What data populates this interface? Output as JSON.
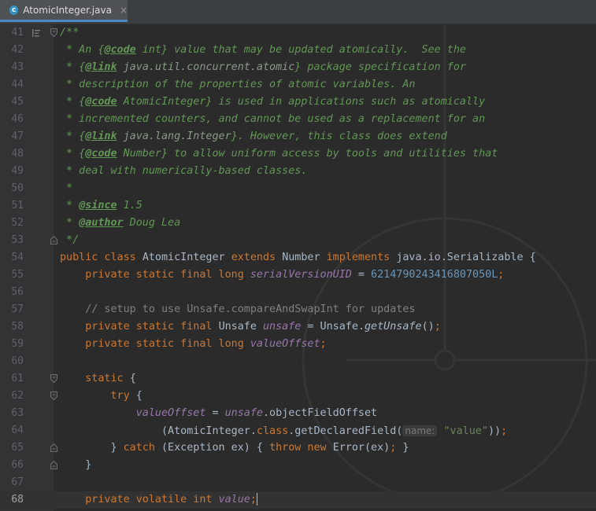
{
  "tab": {
    "filename": "AtomicInteger.java",
    "icon": "java-class-icon",
    "icon_letter": "c",
    "close": "×"
  },
  "editor": {
    "current_line": "68",
    "lines": [
      {
        "n": "41",
        "fold": "start",
        "segs": [
          [
            "cm",
            "/**"
          ]
        ]
      },
      {
        "n": "42",
        "segs": [
          [
            "cm",
            " * An {"
          ],
          [
            "tag",
            "@code"
          ],
          [
            "cm",
            " int} value that may be updated atomically.  See the"
          ]
        ]
      },
      {
        "n": "43",
        "segs": [
          [
            "cm",
            " * {"
          ],
          [
            "tag",
            "@link"
          ],
          [
            "ref",
            " java.util.concurrent.atomic"
          ],
          [
            "cm",
            "} package specification for"
          ]
        ]
      },
      {
        "n": "44",
        "segs": [
          [
            "cm",
            " * description of the properties of atomic variables. An"
          ]
        ]
      },
      {
        "n": "45",
        "segs": [
          [
            "cm",
            " * {"
          ],
          [
            "tag",
            "@code"
          ],
          [
            "cm",
            " AtomicInteger} is used in applications such as atomically"
          ]
        ]
      },
      {
        "n": "46",
        "segs": [
          [
            "cm",
            " * incremented counters, and cannot be used as a replacement for an"
          ]
        ]
      },
      {
        "n": "47",
        "segs": [
          [
            "cm",
            " * {"
          ],
          [
            "tag",
            "@link"
          ],
          [
            "ref",
            " java.lang.Integer"
          ],
          [
            "cm",
            "}. However, this class does extend"
          ]
        ]
      },
      {
        "n": "48",
        "segs": [
          [
            "cm",
            " * {"
          ],
          [
            "tag",
            "@code"
          ],
          [
            "cm",
            " Number} to allow uniform access by tools and utilities that"
          ]
        ]
      },
      {
        "n": "49",
        "segs": [
          [
            "cm",
            " * deal with numerically-based classes."
          ]
        ]
      },
      {
        "n": "50",
        "segs": [
          [
            "cm",
            " *"
          ]
        ]
      },
      {
        "n": "51",
        "segs": [
          [
            "cm",
            " * "
          ],
          [
            "tag",
            "@since"
          ],
          [
            "cm",
            " 1.5"
          ]
        ]
      },
      {
        "n": "52",
        "segs": [
          [
            "cm",
            " * "
          ],
          [
            "tag",
            "@author"
          ],
          [
            "cm",
            " Doug Lea"
          ]
        ]
      },
      {
        "n": "53",
        "fold": "end",
        "segs": [
          [
            "cm",
            " */"
          ]
        ]
      },
      {
        "n": "54",
        "segs": [
          [
            "kw",
            "public class "
          ],
          [
            "",
            "AtomicInteger "
          ],
          [
            "kw",
            "extends "
          ],
          [
            "",
            "Number "
          ],
          [
            "kw",
            "implements "
          ],
          [
            "",
            "java.io.Serializable {"
          ]
        ]
      },
      {
        "n": "55",
        "segs": [
          [
            "",
            "    "
          ],
          [
            "kw",
            "private static final long "
          ],
          [
            "fld",
            "serialVersionUID"
          ],
          [
            "",
            " = "
          ],
          [
            "num",
            "6214790243416807050L"
          ],
          [
            "kw",
            ";"
          ]
        ]
      },
      {
        "n": "56",
        "segs": []
      },
      {
        "n": "57",
        "segs": [
          [
            "",
            "    "
          ],
          [
            "lc",
            "// setup to use Unsafe.compareAndSwapInt for updates"
          ]
        ]
      },
      {
        "n": "58",
        "segs": [
          [
            "",
            "    "
          ],
          [
            "kw",
            "private static final "
          ],
          [
            "",
            "Unsafe "
          ],
          [
            "fld",
            "unsafe"
          ],
          [
            "",
            " = Unsafe."
          ],
          [
            "mth",
            "getUnsafe"
          ],
          [
            "",
            "()"
          ],
          [
            "kw",
            ";"
          ]
        ]
      },
      {
        "n": "59",
        "segs": [
          [
            "",
            "    "
          ],
          [
            "kw",
            "private static final long "
          ],
          [
            "fld",
            "valueOffset"
          ],
          [
            "kw",
            ";"
          ]
        ]
      },
      {
        "n": "60",
        "segs": []
      },
      {
        "n": "61",
        "fold": "start",
        "segs": [
          [
            "",
            "    "
          ],
          [
            "kw",
            "static "
          ],
          [
            "",
            "{"
          ]
        ]
      },
      {
        "n": "62",
        "fold": "start",
        "segs": [
          [
            "",
            "        "
          ],
          [
            "kw",
            "try "
          ],
          [
            "",
            "{"
          ]
        ]
      },
      {
        "n": "63",
        "segs": [
          [
            "",
            "            "
          ],
          [
            "fld",
            "valueOffset"
          ],
          [
            "",
            " = "
          ],
          [
            "fld",
            "unsafe"
          ],
          [
            "",
            ".objectFieldOffset"
          ]
        ]
      },
      {
        "n": "64",
        "segs": [
          [
            "",
            "                (AtomicInteger."
          ],
          [
            "kw",
            "class"
          ],
          [
            "",
            ".getDeclaredField("
          ],
          [
            "hint",
            "name:"
          ],
          [
            "",
            " "
          ],
          [
            "str",
            "\"value\""
          ],
          [
            "",
            "))"
          ],
          [
            "kw",
            ";"
          ]
        ]
      },
      {
        "n": "65",
        "fold": "end",
        "segs": [
          [
            "",
            "        } "
          ],
          [
            "kw",
            "catch "
          ],
          [
            "",
            "(Exception ex) { "
          ],
          [
            "kw",
            "throw new "
          ],
          [
            "",
            "Error(ex)"
          ],
          [
            "kw",
            "; "
          ],
          [
            "",
            "}"
          ]
        ]
      },
      {
        "n": "66",
        "fold": "end",
        "segs": [
          [
            "",
            "    }"
          ]
        ]
      },
      {
        "n": "67",
        "segs": []
      },
      {
        "n": "68",
        "segs": [
          [
            "",
            "    "
          ],
          [
            "kw",
            "private volatile int "
          ],
          [
            "fld",
            "value"
          ],
          [
            "kw",
            ";"
          ],
          [
            "caret",
            ""
          ]
        ]
      }
    ]
  }
}
